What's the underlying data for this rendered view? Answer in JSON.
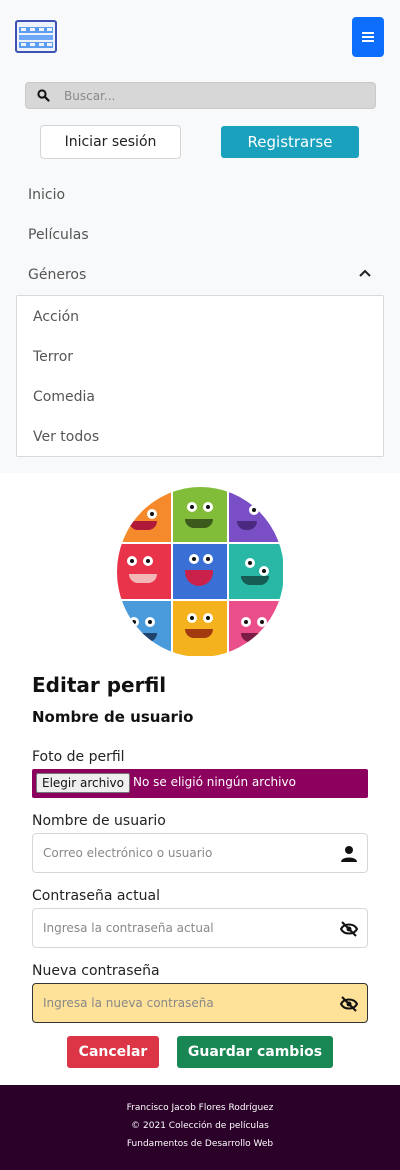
{
  "navbar": {
    "logo_icon": "film-strip-icon",
    "menu_icon": "hamburger-menu-icon",
    "search": {
      "placeholder": "Buscar...",
      "value": ""
    },
    "login_label": "Iniciar sesión",
    "register_label": "Registrarse",
    "links": [
      {
        "label": "Inicio"
      },
      {
        "label": "Películas"
      },
      {
        "label": "Géneros"
      }
    ],
    "genres_dropdown": [
      {
        "label": "Acción"
      },
      {
        "label": "Terror"
      },
      {
        "label": "Comedia"
      },
      {
        "label": "Ver todos"
      }
    ]
  },
  "profile": {
    "avatar_icon": "monster-collage-avatar",
    "title": "Editar perfil",
    "username_heading": "Nombre de usuario",
    "photo_label": "Foto de perfil",
    "file_button_label": "Elegir archivo",
    "file_status": "No se eligió ningún archivo",
    "username_label": "Nombre de usuario",
    "username_placeholder": "Correo electrónico o usuario",
    "current_password_label": "Contraseña actual",
    "current_password_placeholder": "Ingresa la contraseña actual",
    "new_password_label": "Nueva contraseña",
    "new_password_placeholder": "Ingresa la nueva contraseña",
    "cancel_label": "Cancelar",
    "save_label": "Guardar cambios"
  },
  "footer": {
    "author": "Francisco Jacob Flores Rodríguez",
    "copyright": "© 2021 Colección de películas",
    "course": "Fundamentos de Desarrollo Web"
  },
  "colors": {
    "primary": "#0d6efd",
    "info": "#1aa1bd",
    "file_bg": "#8c005e",
    "warning_bg": "#ffe29a",
    "danger": "#dc3545",
    "success": "#198754",
    "footer_bg": "#2b0029"
  }
}
